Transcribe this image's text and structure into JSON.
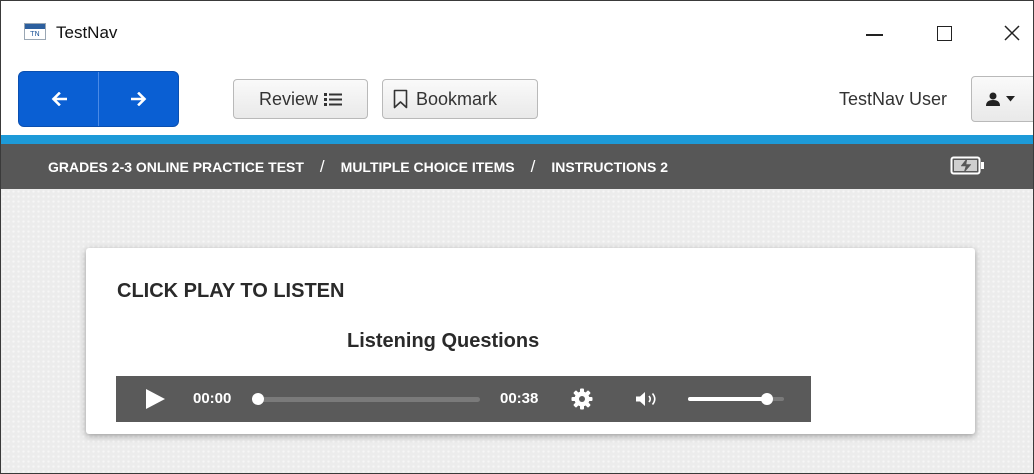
{
  "window": {
    "title": "TestNav",
    "logo_text": "TN",
    "logo_name": "testnav-logo-icon"
  },
  "toolbar": {
    "back_icon": "arrow-left-icon",
    "forward_icon": "arrow-right-icon",
    "review_label": "Review",
    "review_icon": "list-icon",
    "bookmark_label": "Bookmark",
    "bookmark_icon": "bookmark-icon",
    "user_name": "TestNav User",
    "user_menu_icon": "user-icon"
  },
  "breadcrumb": {
    "items": [
      "GRADES 2-3 ONLINE PRACTICE TEST",
      "MULTIPLE CHOICE ITEMS",
      "INSTRUCTIONS 2"
    ],
    "separator": "/",
    "battery_icon": "battery-charging-icon"
  },
  "content": {
    "heading": "CLICK PLAY TO LISTEN",
    "subheading": "Listening Questions"
  },
  "player": {
    "current_time": "00:00",
    "total_time": "00:38",
    "progress": 0,
    "volume": 0.82,
    "play_icon": "play-icon",
    "settings_icon": "gear-icon",
    "volume_icon": "speaker-icon"
  },
  "colors": {
    "nav_blue": "#0a5fd3",
    "accent_blue": "#1d9ad8",
    "crumb_bar": "#575757",
    "player_bg": "#5a5a5a"
  }
}
